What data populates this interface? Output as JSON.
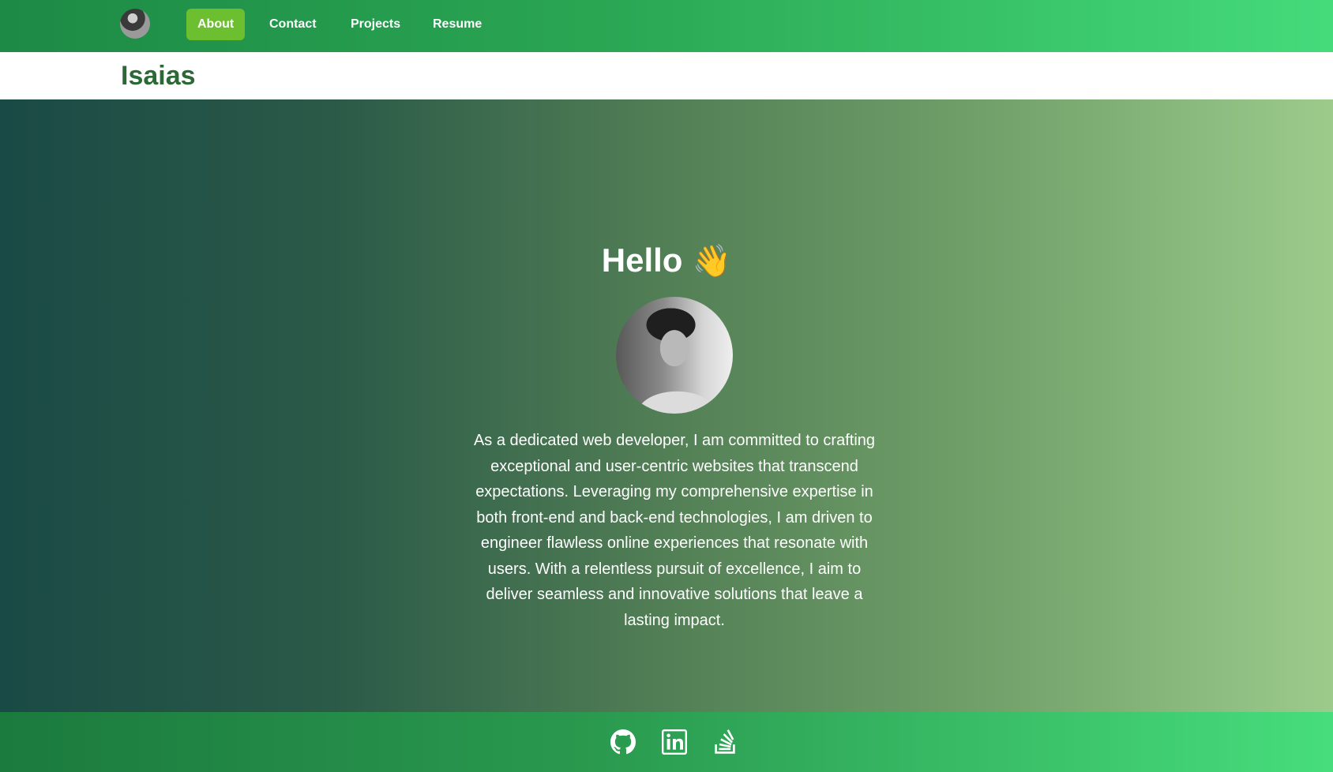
{
  "nav": {
    "links": [
      {
        "label": "About",
        "active": true
      },
      {
        "label": "Contact",
        "active": false
      },
      {
        "label": "Projects",
        "active": false
      },
      {
        "label": "Resume",
        "active": false
      }
    ]
  },
  "header": {
    "brand": "Isaias"
  },
  "hero": {
    "greeting": "Hello",
    "wave": "👋",
    "bio": "As a dedicated web developer, I am committed to crafting exceptional and user-centric websites that transcend expectations. Leveraging my comprehensive expertise in both front-end and back-end technologies, I am driven to engineer flawless online experiences that resonate with users. With a relentless pursuit of excellence, I aim to deliver seamless and innovative solutions that leave a lasting impact."
  },
  "footer": {
    "icons": [
      "github-icon",
      "linkedin-icon",
      "stackoverflow-icon"
    ]
  },
  "colors": {
    "nav_active": "#6cbf2e",
    "brand_text": "#2b6a34",
    "nav_gradient_start": "#1d8a45",
    "nav_gradient_end": "#45db7b"
  }
}
